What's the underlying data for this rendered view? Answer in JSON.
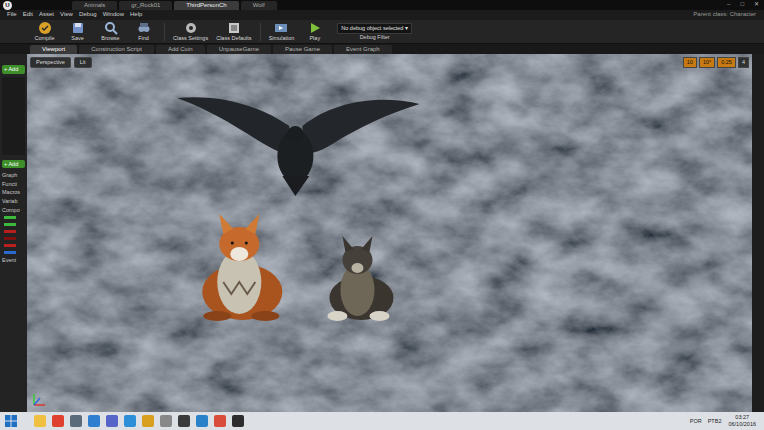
{
  "window": {
    "logo": "U",
    "tabs": [
      {
        "label": "Animals",
        "selected": false
      },
      {
        "label": "gr_Rock01",
        "selected": false
      },
      {
        "label": "ThirdPersonCh",
        "selected": true
      },
      {
        "label": "Wolf",
        "selected": false
      }
    ],
    "controls": [
      "–",
      "□",
      "✕"
    ],
    "parent_class": "Parent class: Character"
  },
  "menu": [
    "File",
    "Edit",
    "Asset",
    "View",
    "Debug",
    "Window",
    "Help"
  ],
  "toolbar": {
    "buttons": [
      {
        "label": "Compile"
      },
      {
        "label": "Save"
      },
      {
        "label": "Browse"
      },
      {
        "label": "Find"
      },
      {
        "label": "Class Settings"
      },
      {
        "label": "Class Defaults"
      },
      {
        "label": "Simulation"
      },
      {
        "label": "Play"
      }
    ],
    "debug_select": "No debug object selected ▾",
    "debug_label": "Debug Filter"
  },
  "editor_tabs": [
    {
      "label": "Viewport",
      "selected": true
    },
    {
      "label": "Construction Script",
      "selected": false
    },
    {
      "label": "Add Coin",
      "selected": false
    },
    {
      "label": "UnpauseGame",
      "selected": false
    },
    {
      "label": "Pause Game",
      "selected": false
    },
    {
      "label": "Event Graph",
      "selected": false
    }
  ],
  "sidebar": {
    "add_top": "+ Add",
    "add_bottom": "+ Add",
    "sections": [
      "Graph",
      "Functi",
      "Macros",
      "Variab",
      "Compo",
      "Event"
    ],
    "variables": [
      {
        "color": "#3cb83c"
      },
      {
        "color": "#3cb83c"
      },
      {
        "color": "#b82020"
      },
      {
        "color": "#7a1010"
      },
      {
        "color": "#b82020"
      },
      {
        "color": "#2a6ad0"
      }
    ]
  },
  "viewport": {
    "view_mode": "Perspective",
    "lighting": "Lit",
    "snap": [
      {
        "label": "10",
        "selected": true
      },
      {
        "label": "10°",
        "selected": true
      },
      {
        "label": "0.25",
        "selected": true
      },
      {
        "label": "4",
        "selected": false
      }
    ]
  },
  "taskbar": {
    "tray": [
      "POR",
      "PTB2"
    ],
    "time": "03:27",
    "date": "06/10/2016"
  }
}
